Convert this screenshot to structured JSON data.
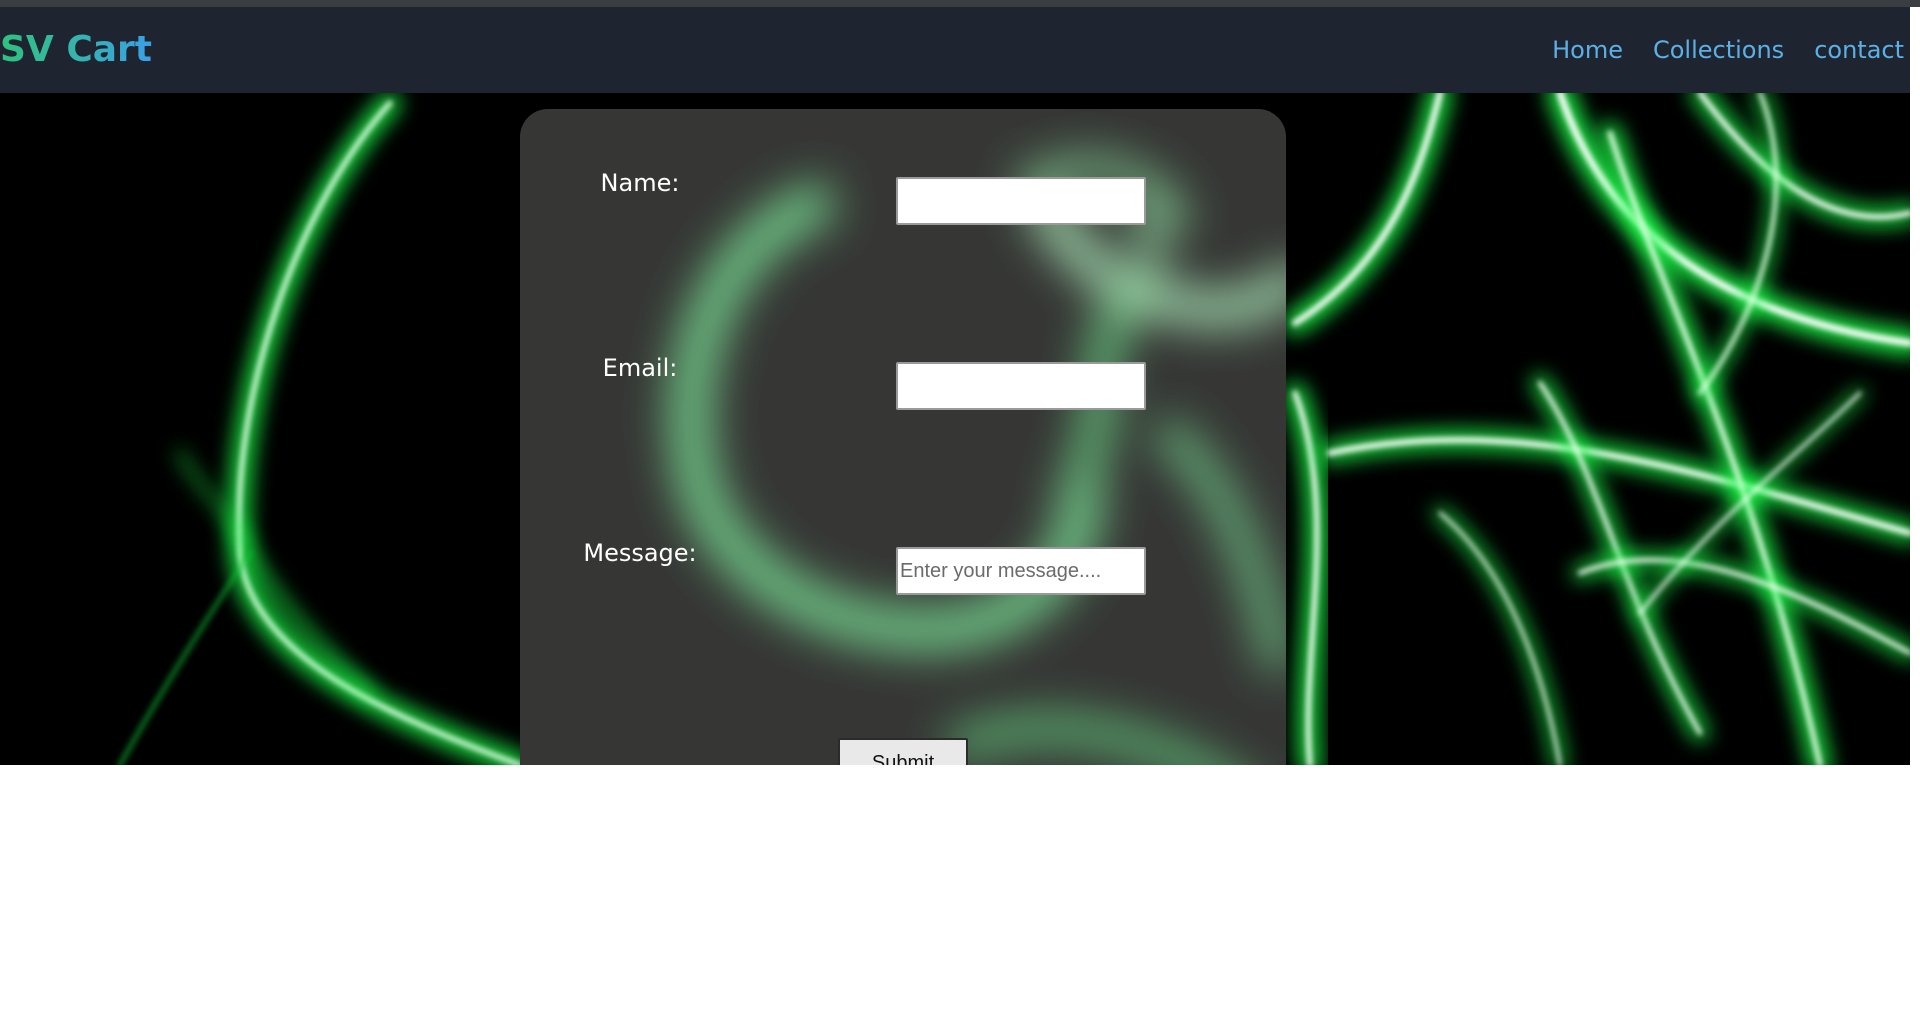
{
  "header": {
    "logo": "SV Cart",
    "nav": [
      {
        "label": "Home"
      },
      {
        "label": "Collections"
      },
      {
        "label": "contact"
      }
    ]
  },
  "form": {
    "name_label": "Name:",
    "email_label": "Email:",
    "message_label": "Message:",
    "name_value": "",
    "email_value": "",
    "message_placeholder": "Enter your message....",
    "submit_label": "Submit"
  },
  "colors": {
    "navbar_bg": "#1e2530",
    "logo_gradient_start": "#2ec27e",
    "logo_gradient_end": "#3aa0e8",
    "nav_link": "#5cb0e6",
    "card_bg": "#363735",
    "glow": "#2aff5a"
  }
}
